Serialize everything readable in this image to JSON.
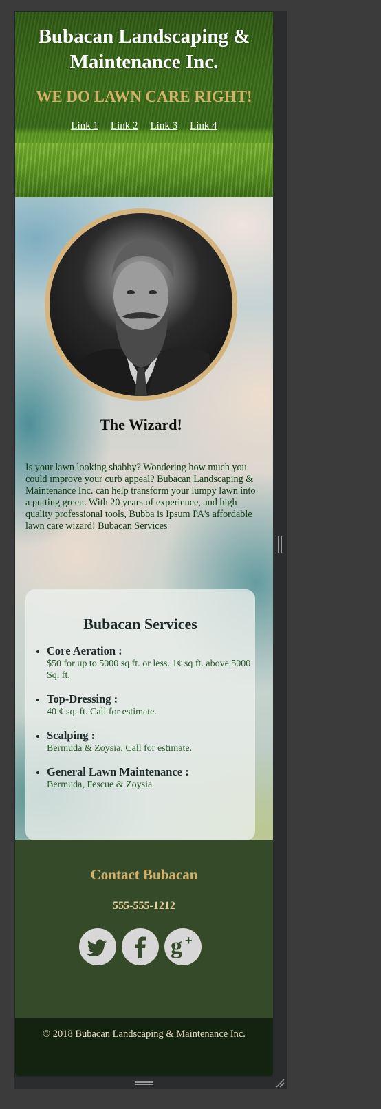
{
  "header": {
    "title": "Bubacan Landscaping & Maintenance Inc.",
    "tagline": "WE DO LAWN CARE RIGHT!",
    "nav": [
      "Link 1",
      "Link 2",
      "Link 3",
      "Link 4"
    ]
  },
  "hero": {
    "heading": "The Wizard!",
    "intro": "Is your lawn looking shabby? Wondering how much you could improve your curb appeal? Bubacan Landscaping & Maintenance Inc. can help transform your lumpy lawn into a putting green. With 20 years of experience, and high quality professional tools, Bubba is Ipsum PA's affordable lawn care wizard! Bubacan Services"
  },
  "services": {
    "heading": "Bubacan Services",
    "items": [
      {
        "name": "Core Aeration :",
        "desc": "$50 for up to 5000 sq ft. or less. 1¢ sq ft. above 5000 Sq. ft."
      },
      {
        "name": "Top-Dressing :",
        "desc": "40 ¢ sq. ft. Call for estimate."
      },
      {
        "name": "Scalping :",
        "desc": "Bermuda & Zoysia. Call for estimate."
      },
      {
        "name": "General Lawn Maintenance :",
        "desc": "Bermuda, Fescue & Zoysia"
      }
    ]
  },
  "contact": {
    "heading": "Contact Bubacan",
    "phone": "555-555-1212",
    "social": [
      "twitter-icon",
      "facebook-icon",
      "google-plus-icon"
    ]
  },
  "footer": {
    "copyright": "© 2018 Bubacan Landscaping & Maintenance Inc."
  },
  "colors": {
    "accent": "#d4b06a",
    "contact_bg": "#344a28",
    "footer_bg": "#14230f"
  }
}
